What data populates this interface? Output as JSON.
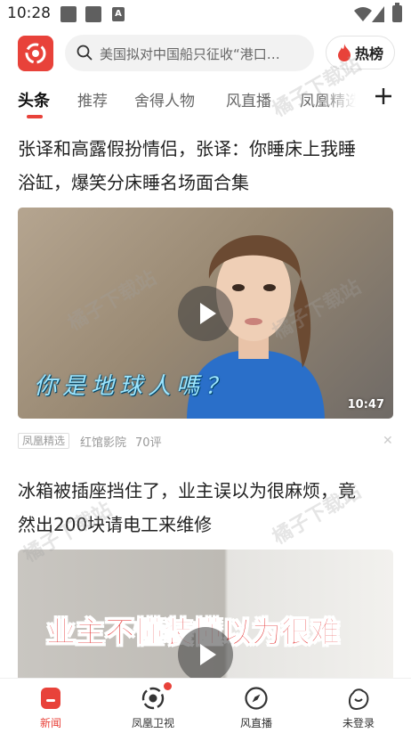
{
  "status_bar": {
    "time": "10:28"
  },
  "header": {
    "search_placeholder": "美国拟对中国船只征收“港口…",
    "hot_label": "热榜"
  },
  "tabs": [
    {
      "label": "头条",
      "active": true
    },
    {
      "label": "推荐"
    },
    {
      "label": "舍得人物"
    },
    {
      "label": "风直播"
    },
    {
      "label": "凤凰精选"
    }
  ],
  "articles": [
    {
      "title_line1": "张译和高露假扮情侣，张译：你睡床上我睡",
      "title_line2": "浴缸，爆笑分床睡名场面合集",
      "video_subtitle": "你是地球人嗎？",
      "duration": "10:47",
      "tag": "凤凰精选",
      "source": "红馆影院",
      "comments": "70评"
    },
    {
      "title_line1": "冰箱被插座挡住了，业主误以为很麻烦，竟",
      "title_line2": "然出200块请电工来维修",
      "video_caption": "业主不懂装懂以为很难"
    }
  ],
  "bottom_nav": [
    {
      "label": "新闻",
      "icon": "news-icon",
      "active": true
    },
    {
      "label": "凤凰卫视",
      "icon": "phoenix-tv-icon"
    },
    {
      "label": "风直播",
      "icon": "compass-icon"
    },
    {
      "label": "未登录",
      "icon": "user-icon"
    }
  ],
  "watermark_text": "橘子下载站",
  "colors": {
    "brand": "#e8423a",
    "text": "#222222",
    "muted": "#999999"
  }
}
